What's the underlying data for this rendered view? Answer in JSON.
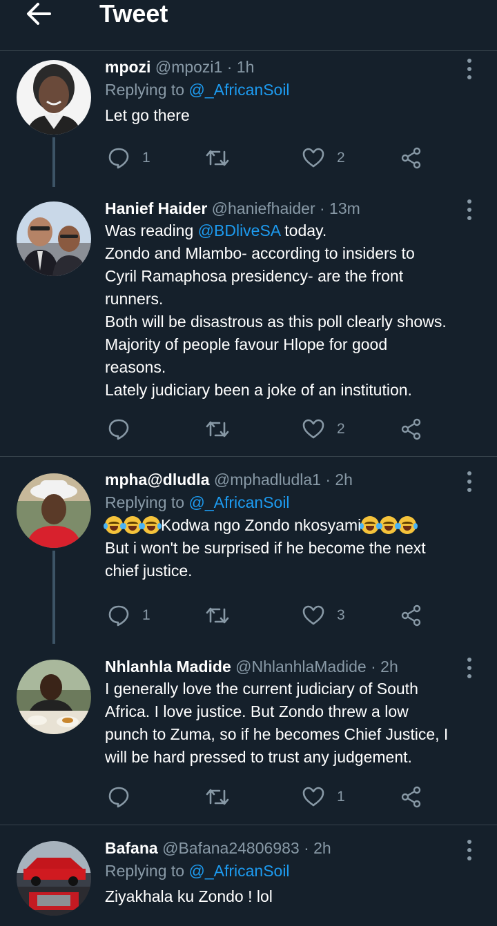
{
  "header": {
    "title": "Tweet",
    "back_icon": "arrow-left-icon"
  },
  "colors": {
    "background": "#15202b",
    "accent": "#1d9bf0",
    "secondary_text": "#8899a6",
    "divider": "#38444d"
  },
  "tweets": [
    {
      "name": "mpozi",
      "handle": "@mpozi1",
      "time": "· 1h",
      "replying_prefix": "Replying to",
      "replying_to": "@_AfricanSoil",
      "text_lines": [
        "Let go there"
      ],
      "reply_count": "1",
      "retweet_count": "",
      "like_count": "2"
    },
    {
      "name": "Hanief Haider",
      "handle": "@haniefhaider",
      "time": "· 13m",
      "text_prefix": "Was reading ",
      "mention": "@BDliveSA",
      "text_suffix": " today.",
      "text_lines": [
        "Zondo and Mlambo- according to insiders to",
        "Cyril Ramaphosa presidency- are the front",
        "runners.",
        "Both will be disastrous as this poll clearly shows.",
        "Majority of people favour Hlope for good",
        "reasons.",
        "Lately judiciary been a joke of an institution."
      ],
      "reply_count": "",
      "retweet_count": "",
      "like_count": "2"
    },
    {
      "name": "mpha@dludla",
      "handle": "@mphadludla1",
      "time": "· 2h",
      "replying_prefix": "Replying to",
      "replying_to": "@_AfricanSoil",
      "emoji_text": "Kodwa ngo Zondo nkosyami",
      "text_lines": [
        "But i won't be surprised if he become the next",
        "chief justice."
      ],
      "reply_count": "1",
      "retweet_count": "",
      "like_count": "3"
    },
    {
      "name": "Nhlanhla Madide",
      "handle": "@NhlanhlaMadide",
      "time": "· 2h",
      "text_lines": [
        "I generally love the current judiciary of South",
        "Africa. I love justice. But Zondo threw a low",
        "punch to Zuma, so if he becomes Chief Justice, I",
        "will be hard pressed to trust any judgement."
      ],
      "reply_count": "",
      "retweet_count": "",
      "like_count": "1"
    },
    {
      "name": "Bafana",
      "handle": "@Bafana24806983",
      "time": "· 2h",
      "replying_prefix": "Replying to",
      "replying_to": "@_AfricanSoil",
      "text_lines": [
        "Ziyakhala ku Zondo ! lol"
      ]
    }
  ]
}
